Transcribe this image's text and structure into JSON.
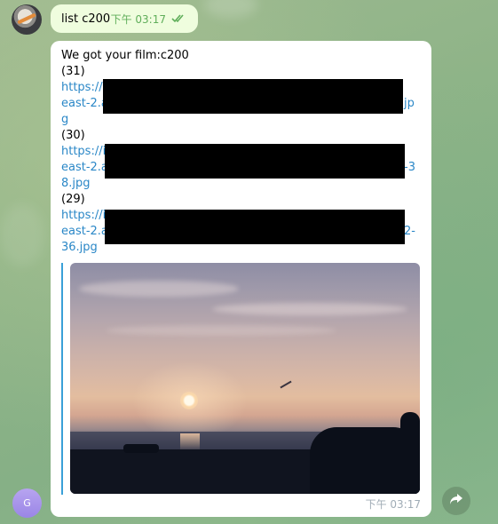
{
  "outgoing": {
    "text": "list c200",
    "time": "下午 03:17",
    "status_icon": "double-check-icon"
  },
  "incoming": {
    "lines": [
      {
        "text": "We got your film:c200",
        "type": "text"
      },
      {
        "text": "(31)",
        "type": "text"
      },
      {
        "text": "https://i",
        "type": "link"
      },
      {
        "text": "east-2.a",
        "type": "link",
        "tail": "jp"
      },
      {
        "text": "g",
        "type": "link"
      },
      {
        "text": "(30)",
        "type": "text"
      },
      {
        "text": "https://i",
        "type": "link"
      },
      {
        "text": "east-2.a",
        "type": "link",
        "tail": "-3"
      },
      {
        "text": "8.jpg",
        "type": "link"
      },
      {
        "text": "(29)",
        "type": "text"
      },
      {
        "text": "https://i",
        "type": "link"
      },
      {
        "text": "east-2.a",
        "type": "link",
        "tail": "2-"
      },
      {
        "text": "36.jpg",
        "type": "link"
      }
    ],
    "time": "下午 03:17",
    "preview_image": "sunset-beach-photo"
  },
  "avatars": {
    "sender_initial": "G",
    "top_avatar": "user-avatar"
  },
  "colors": {
    "outgoing_bubble": "#effdde",
    "incoming_bubble": "#ffffff",
    "link": "#2a87c7",
    "check": "#5fae5a",
    "avatar_g": "#9a86e6"
  }
}
